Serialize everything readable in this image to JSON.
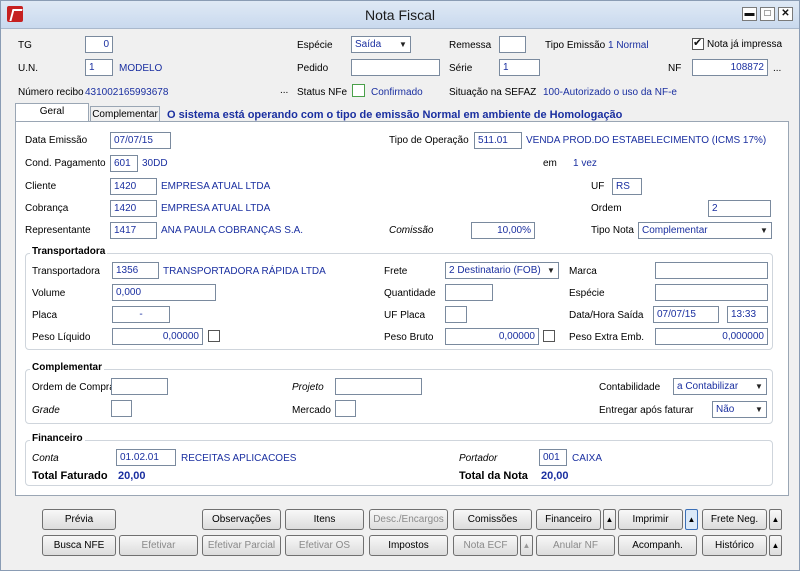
{
  "window": {
    "title": "Nota Fiscal"
  },
  "header": {
    "tg_label": "TG",
    "tg_value": "0",
    "un_label": "U.N.",
    "un_value": "1",
    "un_name": "MODELO",
    "recibo_label": "Número recibo",
    "recibo_value": "431002165993678",
    "especie_label": "Espécie",
    "especie_value": "Saída",
    "pedido_label": "Pedido",
    "pedido_value": "",
    "status_label": "Status NFe",
    "status_value": "Confirmado",
    "remessa_label": "Remessa",
    "remessa_value": "",
    "tipo_emissao_label": "Tipo Emissão",
    "tipo_emissao_value": "1 Normal",
    "serie_label": "Série",
    "serie_value": "1",
    "sefaz_label": "Situação na SEFAZ",
    "sefaz_value": "100-Autorizado o uso da NF-e",
    "impressa_label": "Nota já impressa",
    "nf_label": "NF",
    "nf_value": "108872",
    "ellipsis": "..."
  },
  "tabs": {
    "geral": "Geral",
    "complementar": "Complementar",
    "notice": "O sistema está operando com o tipo de emissão Normal em ambiente de Homologação"
  },
  "geral": {
    "data_emissao_label": "Data Emissão",
    "data_emissao_value": "07/07/15",
    "tipo_operacao_label": "Tipo de Operação",
    "tipo_operacao_code": "511.01",
    "tipo_operacao_desc": "VENDA PROD.DO ESTABELECIMENTO (ICMS 17%)",
    "cond_label": "Cond. Pagamento",
    "cond_code": "601",
    "cond_desc": "30DD",
    "em_label": "em",
    "em_value": "1 vez",
    "cliente_label": "Cliente",
    "cliente_code": "1420",
    "cliente_name": "EMPRESA ATUAL LTDA",
    "uf_label": "UF",
    "uf_value": "RS",
    "cobranca_label": "Cobrança",
    "cobranca_code": "1420",
    "cobranca_name": "EMPRESA ATUAL LTDA",
    "ordem_label": "Ordem",
    "ordem_value": "2",
    "representante_label": "Representante",
    "representante_code": "1417",
    "representante_name": "ANA PAULA COBRANÇAS S.A.",
    "comissao_label": "Comissão",
    "comissao_value": "10,00%",
    "tipo_nota_label": "Tipo Nota",
    "tipo_nota_value": "Complementar"
  },
  "transportadora": {
    "title": "Transportadora",
    "transp_label": "Transportadora",
    "transp_code": "1356",
    "transp_name": "TRANSPORTADORA RÁPIDA LTDA",
    "frete_label": "Frete",
    "frete_value": "2 Destinatario (FOB)",
    "marca_label": "Marca",
    "marca_value": "",
    "volume_label": "Volume",
    "volume_value": "0,000",
    "quantidade_label": "Quantidade",
    "quantidade_value": "",
    "especie_label": "Espécie",
    "especie_value": "",
    "placa_label": "Placa",
    "placa_value": "-",
    "ufplaca_label": "UF Placa",
    "ufplaca_value": "",
    "datahora_label": "Data/Hora Saída",
    "data_value": "07/07/15",
    "hora_value": "13:33",
    "pesoliq_label": "Peso Líquido",
    "pesoliq_value": "0,00000",
    "pesobruto_label": "Peso Bruto",
    "pesobruto_value": "0,00000",
    "pesoextra_label": "Peso Extra Emb.",
    "pesoextra_value": "0,000000"
  },
  "complementar": {
    "title": "Complementar",
    "ordemcompra_label": "Ordem de Compra",
    "ordemcompra_value": "",
    "projeto_label": "Projeto",
    "projeto_value": "",
    "contabilidade_label": "Contabilidade",
    "contabilidade_value": "a Contabilizar",
    "grade_label": "Grade",
    "grade_value": "",
    "mercado_label": "Mercado",
    "mercado_value": "",
    "entregar_label": "Entregar após faturar",
    "entregar_value": "Não"
  },
  "financeiro": {
    "title": "Financeiro",
    "conta_label": "Conta",
    "conta_code": "01.02.01",
    "conta_desc": "RECEITAS APLICACOES",
    "portador_label": "Portador",
    "portador_code": "001",
    "portador_desc": "CAIXA",
    "total_faturado_label": "Total Faturado",
    "total_faturado_value": "20,00",
    "total_nota_label": "Total da Nota",
    "total_nota_value": "20,00"
  },
  "buttons": {
    "previa": "Prévia",
    "observacoes": "Observações",
    "itens": "Itens",
    "desc_encargos": "Desc./Encargos",
    "comissoes": "Comissões",
    "financeiro": "Financeiro",
    "imprimir": "Imprimir",
    "frete_neg": "Frete Neg.",
    "busca_nfe": "Busca NFE",
    "efetivar": "Efetivar",
    "efetivar_parcial": "Efetivar Parcial",
    "efetivar_os": "Efetivar OS",
    "impostos": "Impostos",
    "nota_ecf": "Nota ECF",
    "anular_nf": "Anular NF",
    "acompanh": "Acompanh.",
    "historico": "Histórico"
  }
}
